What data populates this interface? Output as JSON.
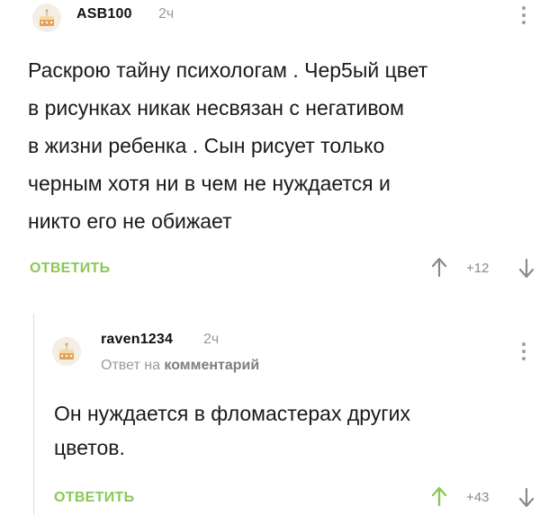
{
  "comments": [
    {
      "avatar_icon": "cake-avatar-icon",
      "username": "ASB100",
      "time": "2ч",
      "text_lines": [
        "Раскрою тайну психологам . Чер5ый цвет",
        "в рисунках никак несвязан с негативом",
        "в жизни ребенка . Сын рисует только",
        "черным хотя ни в чем не нуждается и",
        "никто его не обижает"
      ],
      "reply_label": "ОТВЕТИТЬ",
      "rating": "+12",
      "upvote_icon": "arrow-up-icon",
      "downvote_icon": "arrow-down-icon",
      "more_icon": "more-vertical-icon"
    },
    {
      "avatar_icon": "cake-avatar-icon",
      "username": "raven1234",
      "time": "2ч",
      "reply_prefix": "Ответ на ",
      "reply_target": "комментарий",
      "text_lines": [
        "Он нуждается в фломастерах других",
        "цветов."
      ],
      "reply_label": "ОТВЕТИТЬ",
      "rating": "+43",
      "upvote_icon": "arrow-up-icon",
      "downvote_icon": "arrow-down-icon",
      "more_icon": "more-vertical-icon"
    }
  ],
  "colors": {
    "accent_green": "#8ac858",
    "muted_gray": "#9a9a9a",
    "text": "#1a1a1a"
  }
}
